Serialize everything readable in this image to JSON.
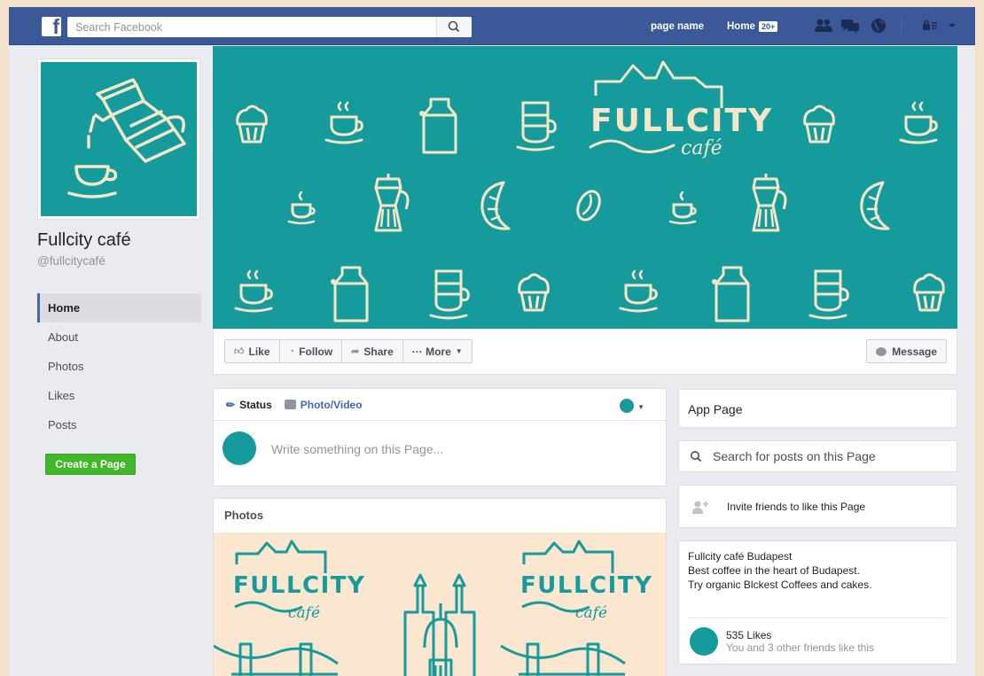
{
  "topbar": {
    "logo_letter": "f",
    "search_placeholder": "Search Facebook",
    "page_name_link": "page name",
    "home_link": "Home",
    "home_badge": "20+",
    "brand_color": "#3b5998"
  },
  "profile": {
    "name": "Fullcity café",
    "handle": "@fullcitycafé",
    "brand_color": "#169b9c"
  },
  "left_nav": {
    "items": [
      {
        "label": "Home",
        "active": true
      },
      {
        "label": "About"
      },
      {
        "label": "Photos"
      },
      {
        "label": "Likes"
      },
      {
        "label": "Posts"
      }
    ],
    "create_page_label": "Create a Page"
  },
  "cover": {
    "logo_word": "FULLCITY",
    "logo_script": "café"
  },
  "actions": {
    "like": "Like",
    "follow": "Follow",
    "share": "Share",
    "more": "··· More",
    "message": "Message"
  },
  "composer": {
    "status_tab": "Status",
    "photo_tab": "Photo/Video",
    "placeholder": "Write something on this Page..."
  },
  "photos": {
    "title": "Photos",
    "logo_word": "FULLCITY",
    "logo_script": "café",
    "bg_color": "#fbe6d0"
  },
  "sidebar": {
    "app_page": "App Page",
    "search_placeholder": "Search for posts on this Page",
    "invite": "Invite friends to like this Page",
    "about_lines": [
      "Fullcity café Budapest",
      "Best coffee in the heart of Budapest.",
      "Try organic Blckest Coffees and cakes."
    ],
    "likes_count": "535 Likes",
    "likes_sub": "You and 3 other friends like this"
  }
}
